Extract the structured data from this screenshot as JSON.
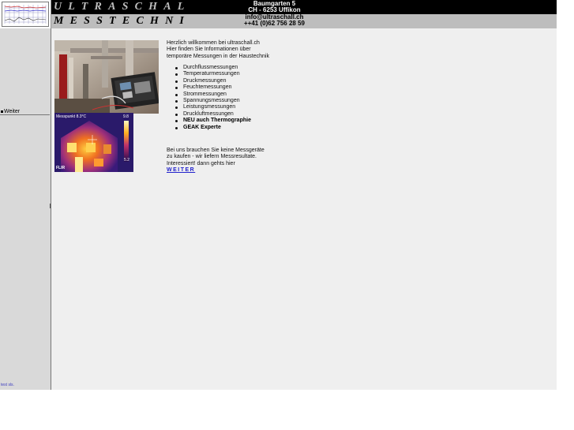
{
  "header": {
    "brand_line1": "ULTRASCHALL",
    "brand_line2": "MESSTECHNIK",
    "address_street": "Baumgarten 5",
    "address_city": "CH - 6253 Uffikon",
    "email": "info@ultraschall.ch",
    "phone": "++41 (0)62 756 28 59"
  },
  "sidebar": {
    "weiter_label": "Weiter",
    "footer_text": "test sls."
  },
  "thermal_image": {
    "label": "Messpunkt",
    "reading": "8.3°C",
    "scale_max": "9.8",
    "scale_min": "5.2",
    "brand": "FLIR"
  },
  "content": {
    "intro_lines": [
      "Herzlich willkommen bei ultraschall.ch",
      "Hier finden Sie Informationen über",
      "temporäre Messungen in der Haustechnik"
    ],
    "services": [
      {
        "label": "Durchflussmessungen",
        "bold": false
      },
      {
        "label": "Temperaturmessungen",
        "bold": false
      },
      {
        "label": "Druckmessungen",
        "bold": false
      },
      {
        "label": "Feuchtemessungen",
        "bold": false
      },
      {
        "label": "Strommessungen",
        "bold": false
      },
      {
        "label": "Spannungsmessungen",
        "bold": false
      },
      {
        "label": "Leistungsmessungen",
        "bold": false
      },
      {
        "label": "Druckluftmessungen",
        "bold": false
      },
      {
        "label": "NEU auch Thermographie",
        "bold": true
      },
      {
        "label": "GEAK Experte",
        "bold": true
      }
    ],
    "outro_lines": [
      "Bei uns brauchen Sie keine Messgeräte",
      "zu kaufen - wir liefern Messresultate.",
      "Interessiert! dann gehts hier"
    ],
    "weiter_link": "WEITER"
  },
  "colors": {
    "header_black": "#000000",
    "header_grey": "#bdbdbd",
    "page_bg": "#efefef",
    "sidebar_bg": "#d9d9d9",
    "link_blue": "#2222cc"
  }
}
